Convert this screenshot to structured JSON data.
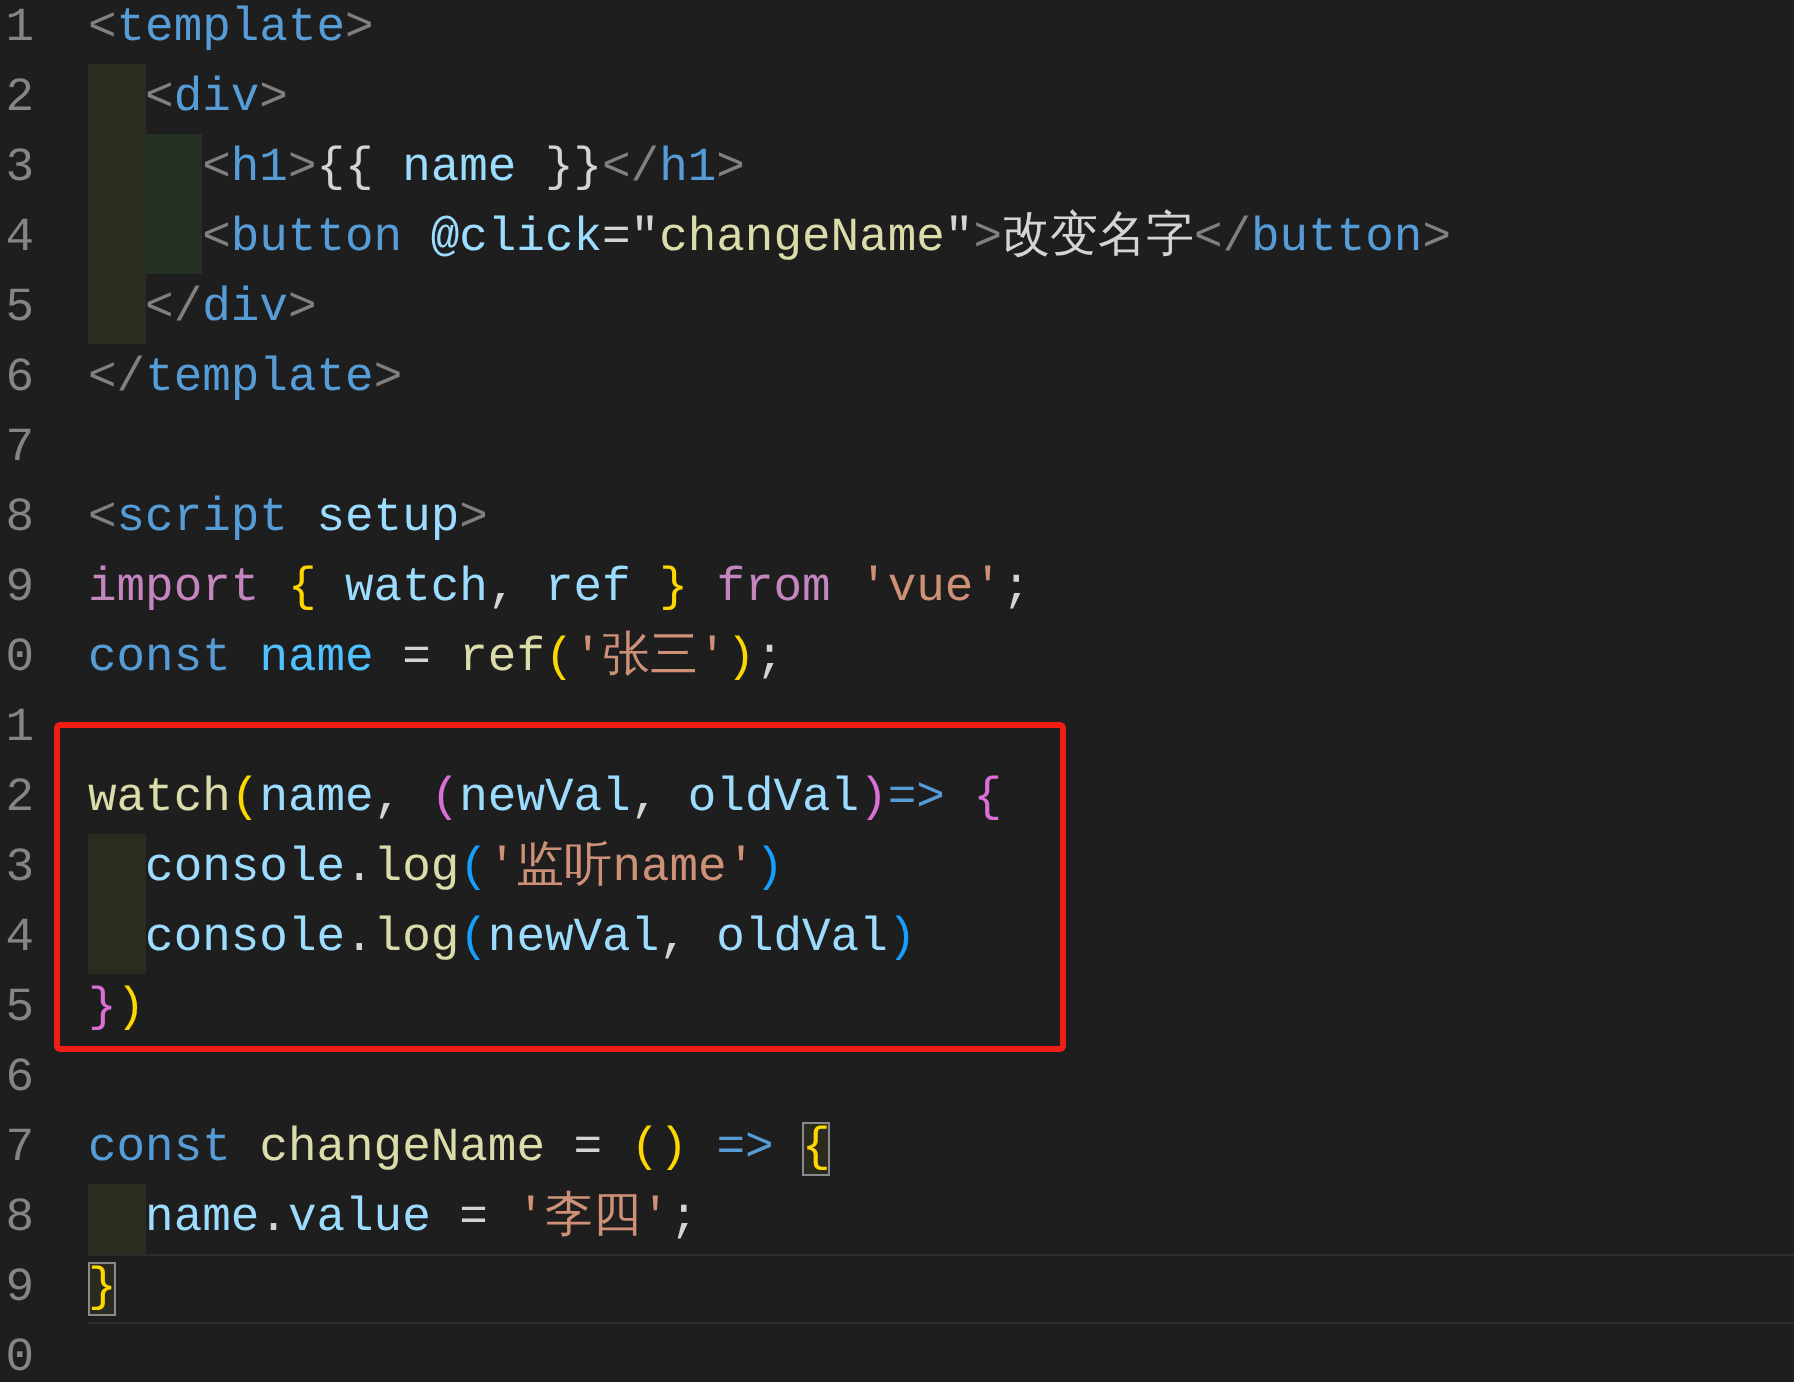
{
  "editor": {
    "lines": [
      {
        "number": "1",
        "current": false,
        "highlighted": false,
        "tokens": [
          {
            "text": "<",
            "kind": "punct"
          },
          {
            "text": "template",
            "kind": "tag"
          },
          {
            "text": ">",
            "kind": "punct"
          }
        ]
      },
      {
        "number": "2",
        "current": false,
        "highlighted": false,
        "tokens": [
          {
            "text": "  <",
            "kind": "punct"
          },
          {
            "text": "div",
            "kind": "tag"
          },
          {
            "text": ">",
            "kind": "punct"
          }
        ]
      },
      {
        "number": "3",
        "current": false,
        "highlighted": false,
        "tokens": [
          {
            "text": "    <",
            "kind": "punct"
          },
          {
            "text": "h1",
            "kind": "tag"
          },
          {
            "text": ">",
            "kind": "punct"
          },
          {
            "text": "{{ ",
            "kind": "plain"
          },
          {
            "text": "name",
            "kind": "variable"
          },
          {
            "text": " }}",
            "kind": "plain"
          },
          {
            "text": "</",
            "kind": "punct"
          },
          {
            "text": "h1",
            "kind": "tag"
          },
          {
            "text": ">",
            "kind": "punct"
          }
        ]
      },
      {
        "number": "4",
        "current": false,
        "highlighted": false,
        "tokens": [
          {
            "text": "    <",
            "kind": "punct"
          },
          {
            "text": "button ",
            "kind": "tag"
          },
          {
            "text": "@click",
            "kind": "variable"
          },
          {
            "text": "=\"",
            "kind": "plain"
          },
          {
            "text": "changeName",
            "kind": "function"
          },
          {
            "text": "\"",
            "kind": "plain"
          },
          {
            "text": ">",
            "kind": "punct"
          },
          {
            "text": "改变名字",
            "kind": "plain"
          },
          {
            "text": "</",
            "kind": "punct"
          },
          {
            "text": "button",
            "kind": "tag"
          },
          {
            "text": ">",
            "kind": "punct"
          }
        ]
      },
      {
        "number": "5",
        "current": false,
        "highlighted": false,
        "tokens": [
          {
            "text": "  </",
            "kind": "punct"
          },
          {
            "text": "div",
            "kind": "tag"
          },
          {
            "text": ">",
            "kind": "punct"
          }
        ]
      },
      {
        "number": "6",
        "current": false,
        "highlighted": false,
        "tokens": [
          {
            "text": "</",
            "kind": "punct"
          },
          {
            "text": "template",
            "kind": "tag"
          },
          {
            "text": ">",
            "kind": "punct"
          }
        ]
      },
      {
        "number": "7",
        "current": false,
        "highlighted": false
      },
      {
        "number": "8",
        "current": false,
        "highlighted": false,
        "tokens": [
          {
            "text": "<",
            "kind": "punct"
          },
          {
            "text": "script ",
            "kind": "tag"
          },
          {
            "text": "setup",
            "kind": "variable"
          },
          {
            "text": ">",
            "kind": "punct"
          }
        ]
      },
      {
        "number": "9",
        "current": false,
        "highlighted": false,
        "tokens": [
          {
            "text": "import ",
            "kind": "keyword"
          },
          {
            "text": "{ ",
            "kind": "bracket1"
          },
          {
            "text": "watch",
            "kind": "variable"
          },
          {
            "text": ", ",
            "kind": "plain"
          },
          {
            "text": "ref ",
            "kind": "variable"
          },
          {
            "text": "} ",
            "kind": "bracket1"
          },
          {
            "text": "from ",
            "kind": "keyword"
          },
          {
            "text": "'vue'",
            "kind": "string"
          },
          {
            "text": ";",
            "kind": "plain"
          }
        ]
      },
      {
        "number": "0",
        "current": false,
        "highlighted": false,
        "tokens": [
          {
            "text": "const ",
            "kind": "storage"
          },
          {
            "text": "name",
            "kind": "constant"
          },
          {
            "text": " = ",
            "kind": "plain"
          },
          {
            "text": "ref",
            "kind": "function"
          },
          {
            "text": "(",
            "kind": "bracket1"
          },
          {
            "text": "'张三'",
            "kind": "string"
          },
          {
            "text": ")",
            "kind": "bracket1"
          },
          {
            "text": ";",
            "kind": "plain"
          }
        ]
      },
      {
        "number": "1",
        "current": false,
        "highlighted": true
      },
      {
        "number": "2",
        "current": false,
        "highlighted": true,
        "tokens": [
          {
            "text": "watch",
            "kind": "function"
          },
          {
            "text": "(",
            "kind": "bracket1"
          },
          {
            "text": "name",
            "kind": "variable"
          },
          {
            "text": ", ",
            "kind": "plain"
          },
          {
            "text": "(",
            "kind": "bracket2"
          },
          {
            "text": "newVal",
            "kind": "variable"
          },
          {
            "text": ", ",
            "kind": "plain"
          },
          {
            "text": "oldVal",
            "kind": "variable"
          },
          {
            "text": ")",
            "kind": "bracket2"
          },
          {
            "text": "=> ",
            "kind": "storage"
          },
          {
            "text": "{",
            "kind": "bracket2"
          }
        ]
      },
      {
        "number": "3",
        "current": false,
        "highlighted": true,
        "tokens": [
          {
            "text": "  console",
            "kind": "variable"
          },
          {
            "text": ".",
            "kind": "plain"
          },
          {
            "text": "log",
            "kind": "function"
          },
          {
            "text": "(",
            "kind": "bracket3"
          },
          {
            "text": "'监听name'",
            "kind": "string"
          },
          {
            "text": ")",
            "kind": "bracket3"
          }
        ]
      },
      {
        "number": "4",
        "current": false,
        "highlighted": true,
        "tokens": [
          {
            "text": "  console",
            "kind": "variable"
          },
          {
            "text": ".",
            "kind": "plain"
          },
          {
            "text": "log",
            "kind": "function"
          },
          {
            "text": "(",
            "kind": "bracket3"
          },
          {
            "text": "newVal",
            "kind": "variable"
          },
          {
            "text": ", ",
            "kind": "plain"
          },
          {
            "text": "oldVal",
            "kind": "variable"
          },
          {
            "text": ")",
            "kind": "bracket3"
          }
        ]
      },
      {
        "number": "5",
        "current": false,
        "highlighted": true,
        "tokens": [
          {
            "text": "}",
            "kind": "bracket2"
          },
          {
            "text": ")",
            "kind": "bracket1"
          }
        ]
      },
      {
        "number": "6",
        "current": false,
        "highlighted": false
      },
      {
        "number": "7",
        "current": false,
        "highlighted": false,
        "tokens": [
          {
            "text": "const ",
            "kind": "storage"
          },
          {
            "text": "changeName",
            "kind": "function"
          },
          {
            "text": " = ",
            "kind": "plain"
          },
          {
            "text": "() ",
            "kind": "bracket1"
          },
          {
            "text": "=> ",
            "kind": "storage"
          },
          {
            "text": "{",
            "kind": "bracket1-matched"
          }
        ]
      },
      {
        "number": "8",
        "current": false,
        "highlighted": false,
        "tokens": [
          {
            "text": "  name",
            "kind": "variable"
          },
          {
            "text": ".",
            "kind": "plain"
          },
          {
            "text": "value",
            "kind": "variable"
          },
          {
            "text": " = ",
            "kind": "plain"
          },
          {
            "text": "'李四'",
            "kind": "string"
          },
          {
            "text": ";",
            "kind": "plain"
          }
        ]
      },
      {
        "number": "9",
        "current": true,
        "highlighted": false,
        "tokens": [
          {
            "text": "}",
            "kind": "bracket1-matched"
          }
        ]
      },
      {
        "number": "0",
        "current": false,
        "highlighted": false
      }
    ]
  }
}
